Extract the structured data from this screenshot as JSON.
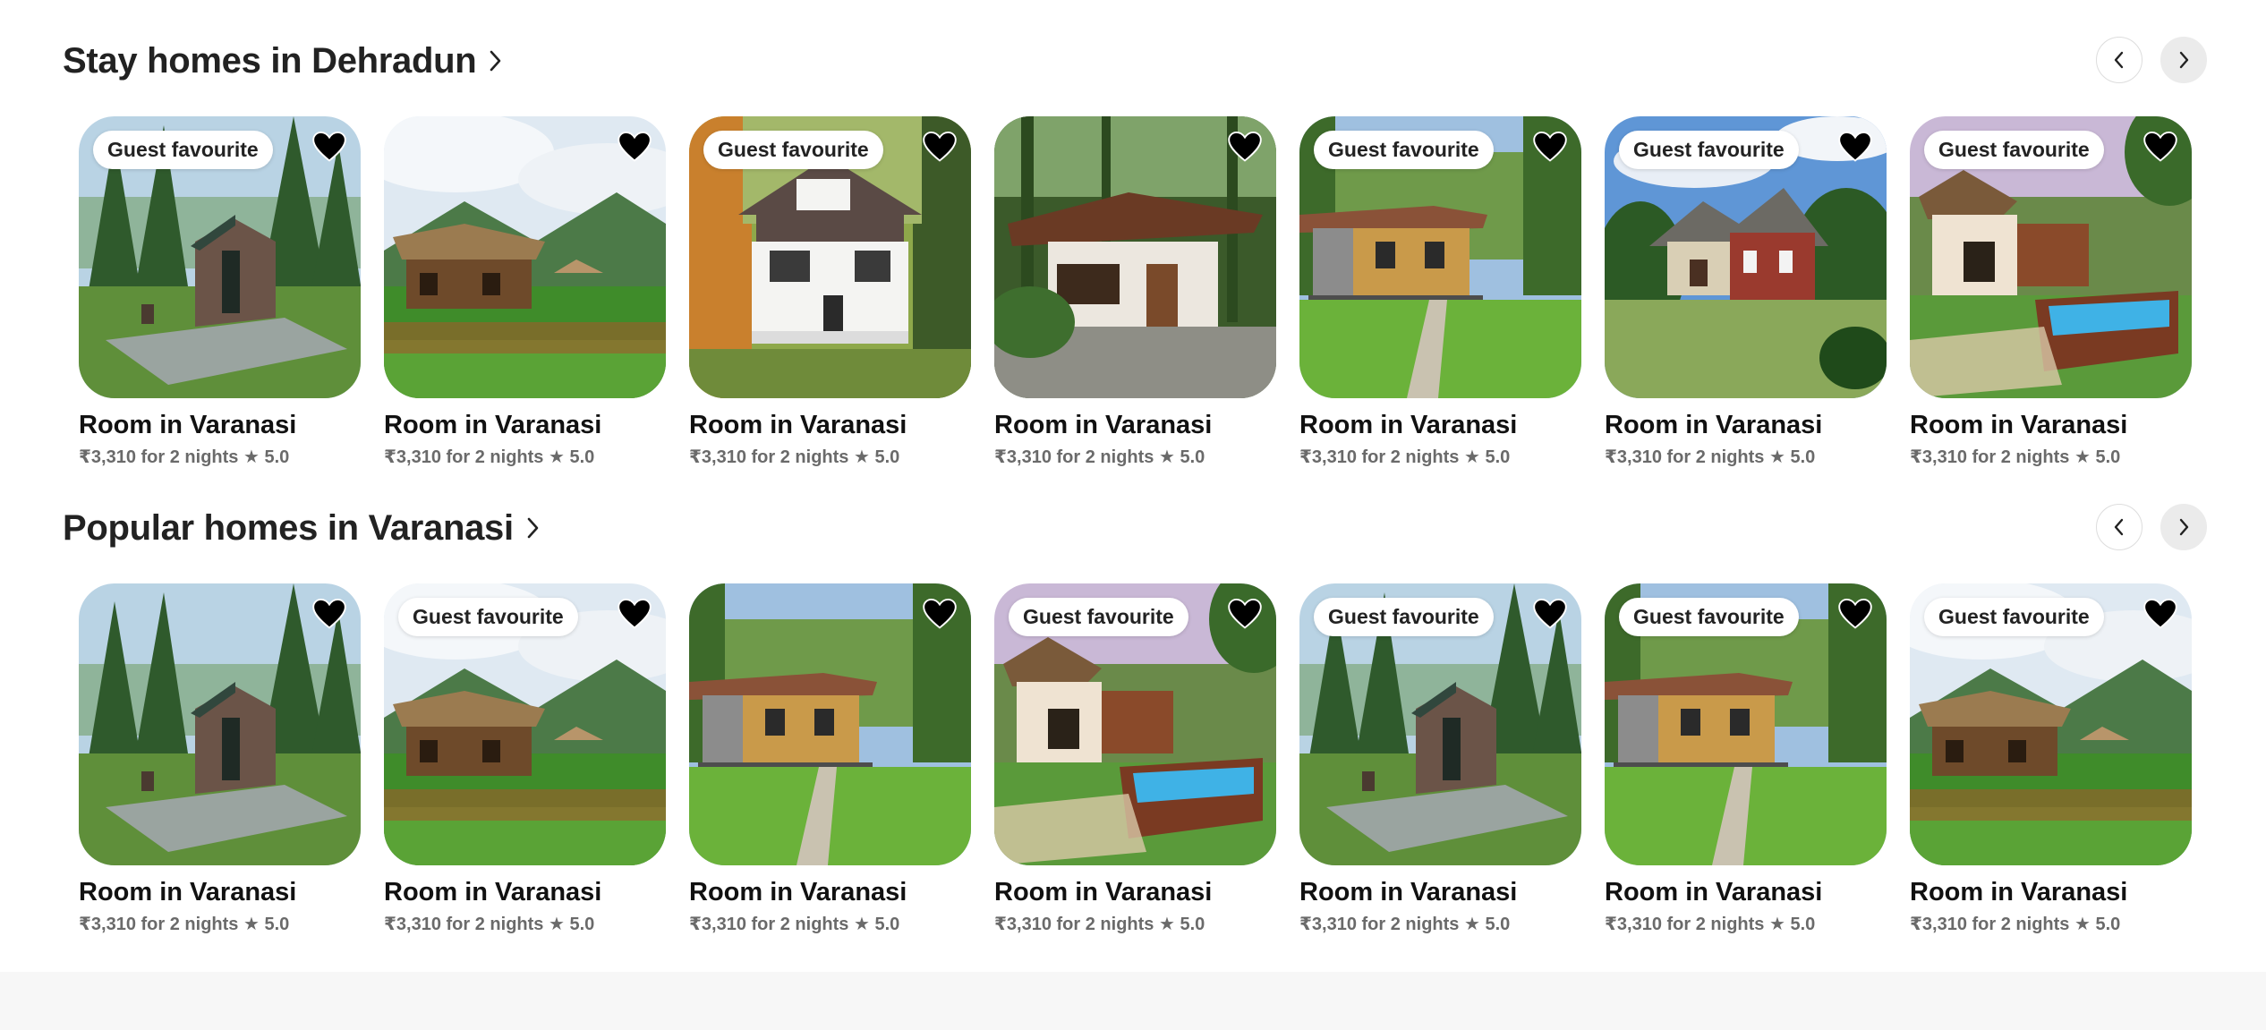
{
  "sections": [
    {
      "title": "Stay homes in Dehradun",
      "cards": [
        {
          "badge": "Guest favourite",
          "title": "Room in Varanasi",
          "subtitle": "₹3,310 for 2 nights ★ 5.0",
          "scene": "cabin-modern"
        },
        {
          "badge": "",
          "title": "Room in Varanasi",
          "subtitle": "₹3,310 for 2 nights ★ 5.0",
          "scene": "hut-mountain"
        },
        {
          "badge": "Guest favourite",
          "title": "Room in Varanasi",
          "subtitle": "₹3,310 for 2 nights ★ 5.0",
          "scene": "house-white"
        },
        {
          "badge": "",
          "title": "Room in Varanasi",
          "subtitle": "₹3,310 for 2 nights ★ 5.0",
          "scene": "cottage-forest"
        },
        {
          "badge": "Guest favourite",
          "title": "Room in Varanasi",
          "subtitle": "₹3,310 for 2 nights ★ 5.0",
          "scene": "bamboo-house"
        },
        {
          "badge": "Guest favourite",
          "title": "Room in Varanasi",
          "subtitle": "₹3,310 for 2 nights ★ 5.0",
          "scene": "brick-house"
        },
        {
          "badge": "Guest favourite",
          "title": "Room in Varanasi",
          "subtitle": "₹3,310 for 2 nights ★ 5.0",
          "scene": "pool-hut"
        }
      ]
    },
    {
      "title": "Popular homes in Varanasi",
      "cards": [
        {
          "badge": "",
          "title": "Room in Varanasi",
          "subtitle": "₹3,310 for 2 nights ★ 5.0",
          "scene": "cabin-modern"
        },
        {
          "badge": "Guest favourite",
          "title": "Room in Varanasi",
          "subtitle": "₹3,310 for 2 nights ★ 5.0",
          "scene": "hut-mountain"
        },
        {
          "badge": "",
          "title": "Room in Varanasi",
          "subtitle": "₹3,310 for 2 nights ★ 5.0",
          "scene": "bamboo-house"
        },
        {
          "badge": "Guest favourite",
          "title": "Room in Varanasi",
          "subtitle": "₹3,310 for 2 nights ★ 5.0",
          "scene": "pool-hut"
        },
        {
          "badge": "Guest favourite",
          "title": "Room in Varanasi",
          "subtitle": "₹3,310 for 2 nights ★ 5.0",
          "scene": "cabin-modern"
        },
        {
          "badge": "Guest favourite",
          "title": "Room in Varanasi",
          "subtitle": "₹3,310 for 2 nights ★ 5.0",
          "scene": "bamboo-house"
        },
        {
          "badge": "Guest favourite",
          "title": "Room in Varanasi",
          "subtitle": "₹3,310 for 2 nights ★ 5.0",
          "scene": "hut-mountain"
        }
      ]
    }
  ],
  "icons": {
    "heart": "heart-icon",
    "title_chevron": "chevron-right-icon",
    "prev": "chevron-left-icon",
    "next": "chevron-right-icon"
  },
  "colors": {
    "text": "#222222",
    "subtext": "#6a6a6a",
    "nav_next_bg": "#ebebeb",
    "footer_bg": "#f7f7f7"
  }
}
